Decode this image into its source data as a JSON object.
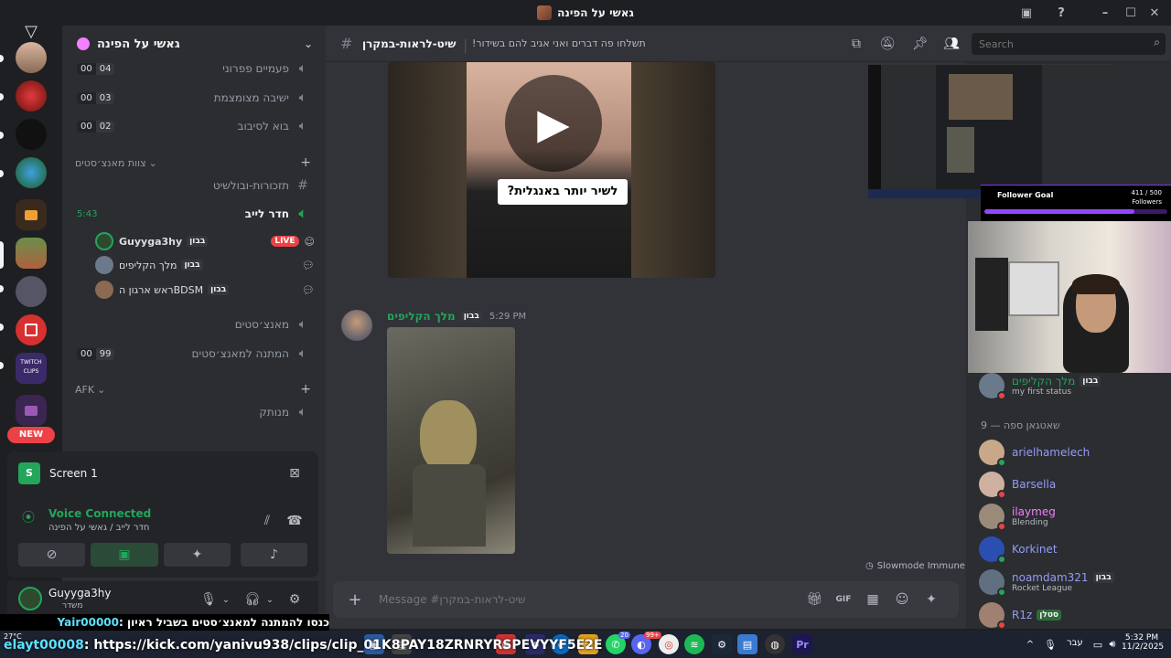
{
  "window": {
    "title": "גאשי על הפינה"
  },
  "server": {
    "name": "גאשי על הפינה"
  },
  "rail": {
    "new_badge": "NEW"
  },
  "channels": [
    {
      "name": "פעמיים פפרוני",
      "c1": "00",
      "c2": "04"
    },
    {
      "name": "ישיבה מצומצמת",
      "c1": "00",
      "c2": "03"
    },
    {
      "name": "בוא לסיבוב",
      "c1": "00",
      "c2": "02"
    }
  ],
  "category_1": {
    "label": "צוות מאנצ׳סטים"
  },
  "text_channel": {
    "name": "תזכורות-ובולשיט"
  },
  "live_channel": {
    "name": "חדר לייב",
    "time": "5:43"
  },
  "voice_users": [
    {
      "name": "Guyyga3hy",
      "tag": "בבון",
      "live": "LIVE"
    },
    {
      "name": "מלך הקליפים",
      "tag": "בבון"
    },
    {
      "name": "ראש ארגון הBDSM",
      "tag": "בבון"
    }
  ],
  "channels_2": [
    {
      "name": "מאנצ׳סטים"
    },
    {
      "name": "המתנה למאנצ׳סטים",
      "c1": "00",
      "c2": "99"
    }
  ],
  "category_afk": {
    "label": "AFK"
  },
  "afk_channel": {
    "name": "מנותק"
  },
  "rtc": {
    "screen_label": "Screen 1",
    "status": "Voice Connected",
    "location": "חדר לייב / גאשי על הפינה"
  },
  "user": {
    "name": "Guyyga3hy",
    "status": "משדר"
  },
  "chat_header": {
    "channel": "שיט-לראות-במקרן",
    "topic": "!תשלחו פה דברים ואני אגיב להם בשידור",
    "search_placeholder": "Search"
  },
  "video": {
    "caption": "לשיר יותר באנגלית?"
  },
  "message": {
    "author": "מלך הקליפים",
    "tag": "בבון",
    "time": "5:29 PM"
  },
  "chat": {
    "slowmode": "Slowmode Immune",
    "input_placeholder": "Message #שיט-לראות-במקרן"
  },
  "stream_overlay": {
    "follower_goal": "Follower Goal",
    "goal_count": "411 / 500",
    "goal_sub": "Followers"
  },
  "members": {
    "top_user": {
      "name": "מלך הקליפים",
      "tag": "בבון",
      "status": "my first status"
    },
    "section": "שאטגאן ספה — 9",
    "list": [
      {
        "name": "arielhamelech",
        "sub": "",
        "color": "#949cf7"
      },
      {
        "name": "Barsella",
        "sub": "",
        "color": "#949cf7"
      },
      {
        "name": "ilaymeg",
        "sub": "Blending",
        "color": "#f47fff"
      },
      {
        "name": "Korkinet",
        "sub": "",
        "color": "#949cf7"
      },
      {
        "name": "noamdam321",
        "sub": "Rocket League",
        "color": "#949cf7",
        "tag": "בבון"
      },
      {
        "name": "R1z",
        "sub": "",
        "color": "#949cf7",
        "tag": "סטלן"
      }
    ]
  },
  "ticker": {
    "line1_text": "כנסו להמתנה למאנצ׳סטים בשביל ראיון : ",
    "line1_user": "Yair00000",
    "line2_user": "elayt00008",
    "line2_text": " : https://kick.com/yanivu938/clips/clip_01K8PAY18ZRNRYRSPEVYYF5E2E"
  },
  "taskbar": {
    "weather": "27°C",
    "lang": "עבר",
    "time": "5:32 PM",
    "date": "11/2/2025",
    "badge1": "20",
    "badge2": "99+"
  },
  "colors": {
    "accent": "#5865f2",
    "green": "#23a55a",
    "live": "#ed4245",
    "twitch": "#9146ff"
  }
}
